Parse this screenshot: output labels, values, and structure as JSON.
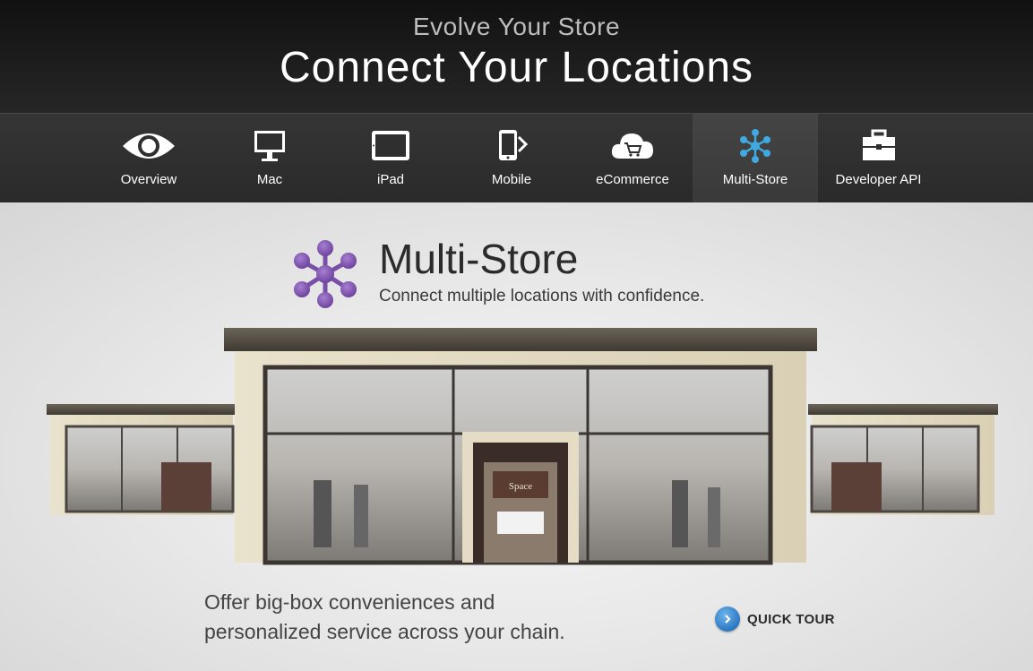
{
  "header": {
    "supertitle": "Evolve Your Store",
    "title": "Connect Your Locations"
  },
  "nav": {
    "items": [
      {
        "label": "Overview",
        "icon": "eye-icon"
      },
      {
        "label": "Mac",
        "icon": "monitor-icon"
      },
      {
        "label": "iPad",
        "icon": "tablet-icon"
      },
      {
        "label": "Mobile",
        "icon": "mobile-phone-icon"
      },
      {
        "label": "eCommerce",
        "icon": "cloud-cart-icon"
      },
      {
        "label": "Multi-Store",
        "icon": "network-nodes-icon",
        "active": true
      },
      {
        "label": "Developer API",
        "icon": "toolbox-icon"
      }
    ]
  },
  "hero": {
    "title": "Multi-Store",
    "subtitle": "Connect multiple locations with confidence.",
    "logo_icon": "network-nodes-icon",
    "store_sign": "Space"
  },
  "tagline": {
    "line1": "Offer big-box conveniences and",
    "line2": "personalized service across your chain."
  },
  "quick_tour": {
    "label": "QUICK TOUR",
    "icon": "chevron-right-icon"
  },
  "colors": {
    "header_bg": "#1a1a1a",
    "nav_bg": "#2f2f2f",
    "nav_active_bg": "#404040",
    "accent_purple": "#7a4fa8",
    "accent_blue": "#3fa9e0",
    "tour_button_blue": "#2a78c2"
  }
}
